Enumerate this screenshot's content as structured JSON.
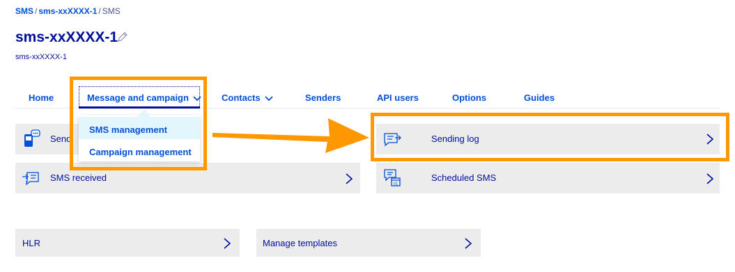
{
  "breadcrumb": {
    "items": [
      "SMS",
      "sms-xxXXXX-1"
    ],
    "separator": "/",
    "current": "SMS"
  },
  "header": {
    "title": "sms-xxXXXX-1",
    "subtitle": "sms-xxXXXX-1"
  },
  "tabs": [
    {
      "label": "Home"
    },
    {
      "label": "Message and campaign",
      "has_dropdown": true,
      "active": true
    },
    {
      "label": "Contacts",
      "has_dropdown": true
    },
    {
      "label": "Senders"
    },
    {
      "label": "API users"
    },
    {
      "label": "Options"
    },
    {
      "label": "Guides"
    }
  ],
  "dropdown": {
    "items": [
      {
        "label": "SMS management",
        "selected": true
      },
      {
        "label": "Campaign management"
      }
    ]
  },
  "tiles": {
    "sending": {
      "label": "Sendi",
      "icon": "phone-sms-icon"
    },
    "sms_received": {
      "label": "SMS received",
      "icon": "message-in-icon"
    },
    "sending_log": {
      "label": "Sending log",
      "icon": "message-out-icon"
    },
    "scheduled_sms": {
      "label": "Scheduled SMS",
      "icon": "calendar-message-icon"
    },
    "hlr": {
      "label": "HLR"
    },
    "manage_templates": {
      "label": "Manage templates"
    }
  },
  "colors": {
    "brand": "#000e9c",
    "link": "#0050d7",
    "highlight": "#ff9800",
    "tile_bg": "#ececec",
    "dropdown_selected": "#e3f6fc"
  }
}
